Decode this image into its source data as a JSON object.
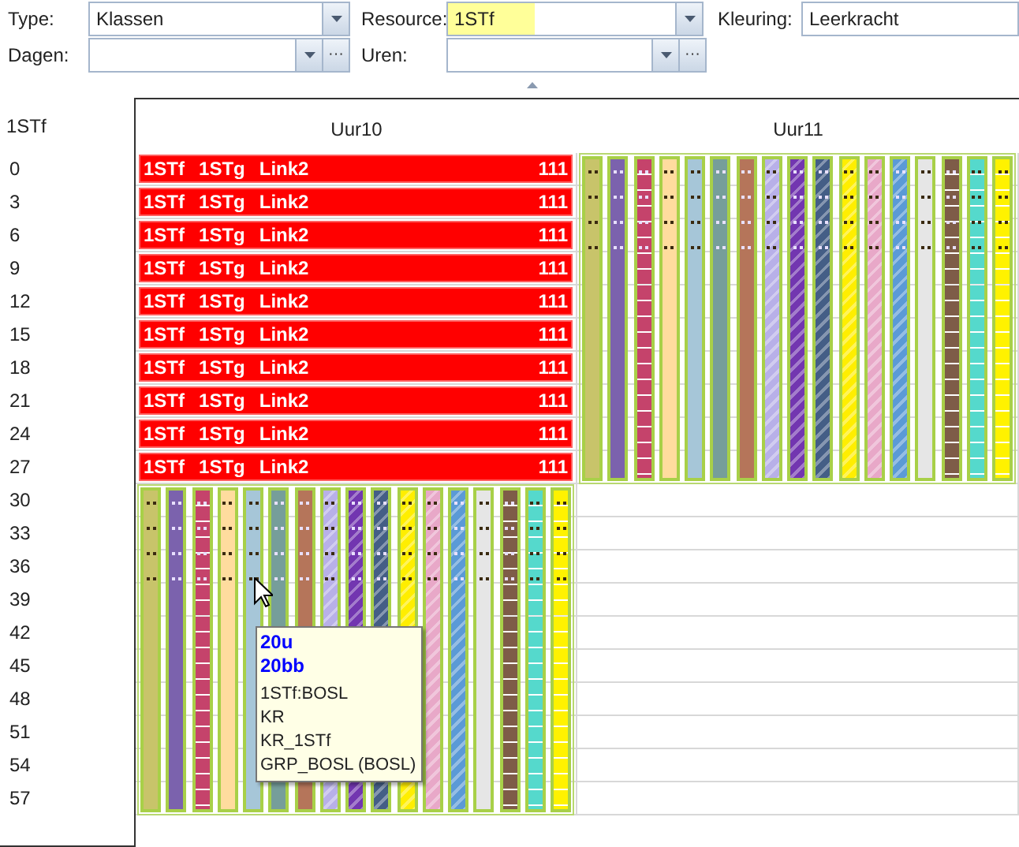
{
  "filters": {
    "type": {
      "label": "Type:",
      "value": "Klassen"
    },
    "resource": {
      "label": "Resource:",
      "value": "1STf",
      "highlighted": true
    },
    "kleuring": {
      "label": "Kleuring:",
      "value": "Leerkracht"
    },
    "dagen": {
      "label": "Dagen:",
      "more_button": "···"
    },
    "uren": {
      "label": "Uren:",
      "more_button": "···"
    }
  },
  "grid": {
    "resource": "1STf",
    "rows": [
      "0",
      "3",
      "6",
      "9",
      "12",
      "15",
      "18",
      "21",
      "24",
      "27",
      "30",
      "33",
      "36",
      "39",
      "42",
      "45",
      "48",
      "51",
      "54",
      "57"
    ],
    "columns": [
      {
        "label": "Uur10",
        "top": {
          "kind": "lessons",
          "lessons": [
            {
              "texts": [
                "1STf",
                "1STg",
                "Link2"
              ],
              "number": "111"
            },
            {
              "texts": [
                "1STf",
                "1STg",
                "Link2"
              ],
              "number": "111"
            },
            {
              "texts": [
                "1STf",
                "1STg",
                "Link2"
              ],
              "number": "111"
            },
            {
              "texts": [
                "1STf",
                "1STg",
                "Link2"
              ],
              "number": "111"
            },
            {
              "texts": [
                "1STf",
                "1STg",
                "Link2"
              ],
              "number": "111"
            },
            {
              "texts": [
                "1STf",
                "1STg",
                "Link2"
              ],
              "number": "111"
            },
            {
              "texts": [
                "1STf",
                "1STg",
                "Link2"
              ],
              "number": "111"
            },
            {
              "texts": [
                "1STf",
                "1STg",
                "Link2"
              ],
              "number": "111"
            },
            {
              "texts": [
                "1STf",
                "1STg",
                "Link2"
              ],
              "number": "111"
            },
            {
              "texts": [
                "1STf",
                "1STg",
                "Link2"
              ],
              "number": "111"
            }
          ]
        },
        "bottom": {
          "kind": "stripes",
          "stripes": [
            {
              "color": "#c8c46a",
              "kind": "solid"
            },
            {
              "color": "#7b62ad",
              "kind": "solid"
            },
            {
              "color": "#c5436b",
              "kind": "lined"
            },
            {
              "color": "#ffdc9e",
              "kind": "solid"
            },
            {
              "color": "#a6c6d8",
              "kind": "solid"
            },
            {
              "color": "#769e9a",
              "kind": "solid"
            },
            {
              "color": "#b5755a",
              "kind": "solid"
            },
            {
              "color": "#b8b0e8",
              "kind": "hatched"
            },
            {
              "color": "#7236b0",
              "kind": "hatched"
            },
            {
              "color": "#445e86",
              "kind": "hatched"
            },
            {
              "color": "#ffee00",
              "kind": "hatched"
            },
            {
              "color": "#e8a8c8",
              "kind": "hatched"
            },
            {
              "color": "#5b9ad6",
              "kind": "hatched"
            },
            {
              "color": "#e6e6e6",
              "kind": "solid"
            },
            {
              "color": "#7e5c48",
              "kind": "lined"
            },
            {
              "color": "#55d9cc",
              "kind": "lined"
            },
            {
              "color": "#fff200",
              "kind": "lined"
            }
          ]
        }
      },
      {
        "label": "Uur11",
        "top": {
          "kind": "stripes",
          "stripes": [
            {
              "color": "#c8c46a",
              "kind": "solid"
            },
            {
              "color": "#7b62ad",
              "kind": "solid"
            },
            {
              "color": "#c5436b",
              "kind": "lined"
            },
            {
              "color": "#ffdc9e",
              "kind": "solid"
            },
            {
              "color": "#a6c6d8",
              "kind": "solid"
            },
            {
              "color": "#769e9a",
              "kind": "solid"
            },
            {
              "color": "#b5755a",
              "kind": "solid"
            },
            {
              "color": "#b8b0e8",
              "kind": "hatched"
            },
            {
              "color": "#7236b0",
              "kind": "hatched"
            },
            {
              "color": "#445e86",
              "kind": "hatched"
            },
            {
              "color": "#ffee00",
              "kind": "hatched"
            },
            {
              "color": "#e8a8c8",
              "kind": "hatched"
            },
            {
              "color": "#5b9ad6",
              "kind": "hatched"
            },
            {
              "color": "#e6e6e6",
              "kind": "solid"
            },
            {
              "color": "#7e5c48",
              "kind": "lined"
            },
            {
              "color": "#55d9cc",
              "kind": "lined"
            },
            {
              "color": "#fff200",
              "kind": "lined"
            }
          ]
        },
        "bottom": {
          "kind": "empty"
        }
      }
    ]
  },
  "tooltip": {
    "lines": [
      {
        "text": "20u",
        "emphasis": true
      },
      {
        "text": "20bb",
        "emphasis": true
      },
      {
        "text": "1STf:BOSL",
        "emphasis": false
      },
      {
        "text": "KR",
        "emphasis": false
      },
      {
        "text": "KR_1STf",
        "emphasis": false
      },
      {
        "text": "GRP_BOSL (BOSL)",
        "emphasis": false
      }
    ]
  }
}
